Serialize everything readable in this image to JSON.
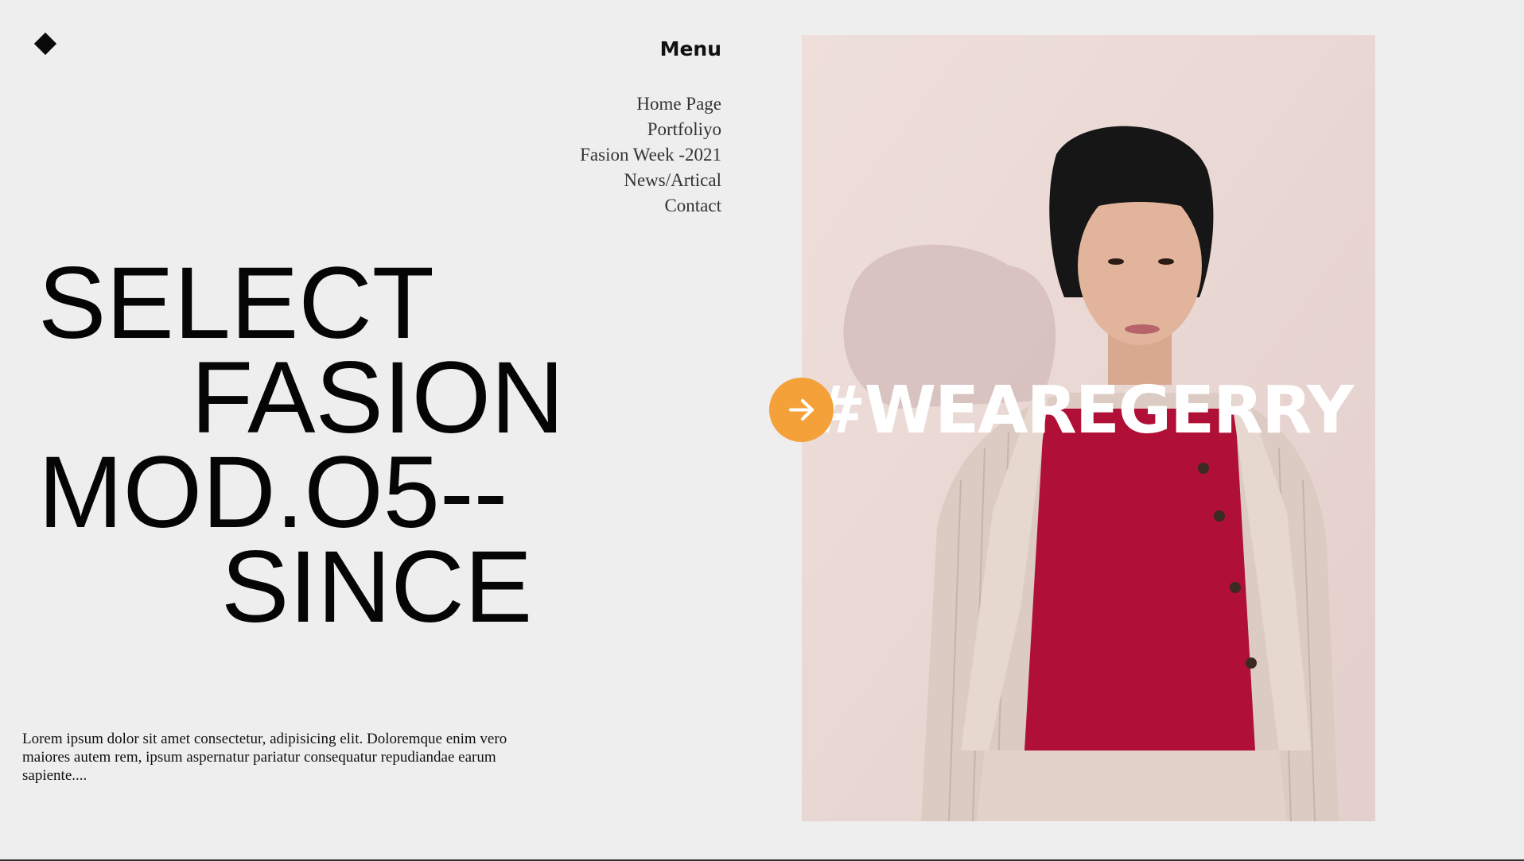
{
  "header": {
    "logo_icon": "diamond-icon",
    "menu_title": "Menu"
  },
  "nav": {
    "items": [
      {
        "label": "Home Page"
      },
      {
        "label": "Portfoliyo"
      },
      {
        "label": "Fasion Week -2021"
      },
      {
        "label": "News/Artical"
      },
      {
        "label": "Contact"
      }
    ]
  },
  "hero": {
    "line1": "SELECT",
    "line2": "FASION",
    "line3": "MOD.O5--",
    "line4": "SINCE"
  },
  "description": "Lorem ipsum dolor sit amet consectetur, adipisicing elit. Doloremque enim vero maiores autem rem, ipsum aspernatur pariatur consequatur repudiandae earum sapiente....",
  "feature": {
    "hashtag": "#WEAREGERRY",
    "next_icon": "arrow-right-icon",
    "accent_color": "#f4a13a"
  }
}
